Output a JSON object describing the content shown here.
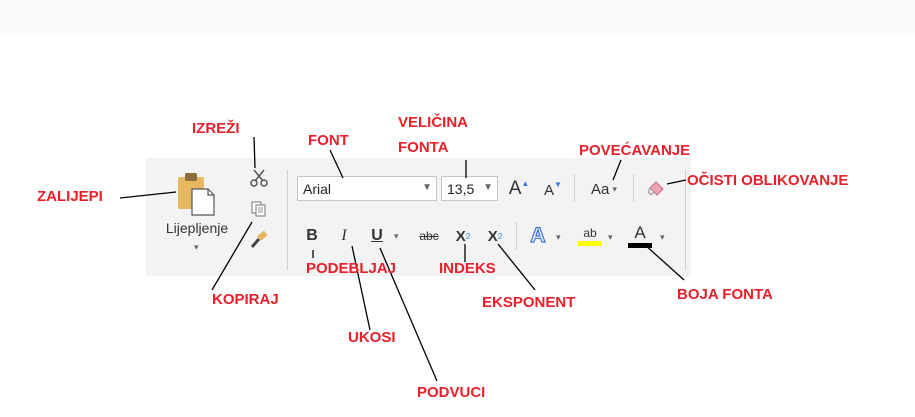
{
  "ribbon": {
    "paste_label": "Lijepljenje",
    "font_name": "Arial",
    "font_size": "13,5",
    "grow_font": "A",
    "shrink_font": "A",
    "change_case": "Aa",
    "bold": "B",
    "italic": "I",
    "underline": "U",
    "strikethrough": "abc",
    "subscript": "X",
    "subscript_mark": "2",
    "superscript": "X",
    "superscript_mark": "2",
    "text_effects": "A",
    "highlight": "ab",
    "font_color": "A"
  },
  "annotations": {
    "zalijepi": "ZALIJEPI",
    "izrezi": "IZREŽI",
    "kopiraj": "KOPIRAJ",
    "font": "FONT",
    "velicina_1": "VELIČINA",
    "velicina_2": "FONTA",
    "povecavanje": "POVEĆAVANJE",
    "ocisti": "OČISTI OBLIKOVANJE",
    "podebljaj": "PODEBLJAJ",
    "ukosi": "UKOSI",
    "podvuci": "PODVUCI",
    "indeks": "INDEKS",
    "eksponent": "EKSPONENT",
    "boja_fonta": "BOJA FONTA"
  },
  "colors": {
    "annotation": "#e8202a",
    "highlight": "#ffff00",
    "font_color_bar": "#000000",
    "text_effects": "#3a6fd8"
  }
}
